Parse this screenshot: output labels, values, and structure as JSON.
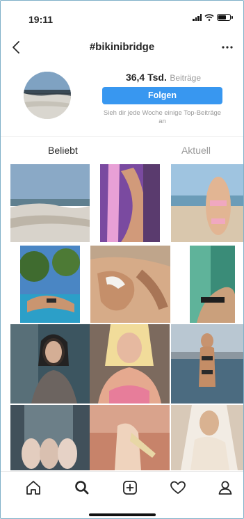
{
  "status_bar": {
    "time": "19:11"
  },
  "nav": {
    "title": "#bikinibridge",
    "back_icon": "chevron-left-icon",
    "more_icon": "more-dots-icon"
  },
  "header": {
    "post_count": "36,4 Tsd.",
    "post_count_label": "Beiträge",
    "follow_label": "Folgen",
    "note": "Sieh dir jede Woche einige Top-Beiträge an"
  },
  "tabs": [
    {
      "label": "Beliebt",
      "active": true
    },
    {
      "label": "Aktuell",
      "active": false
    }
  ],
  "bottom_nav": [
    {
      "icon": "home-icon"
    },
    {
      "icon": "search-icon",
      "active": true
    },
    {
      "icon": "add-post-icon"
    },
    {
      "icon": "heart-icon"
    },
    {
      "icon": "profile-icon"
    }
  ],
  "colors": {
    "accent": "#3897f0",
    "text": "#262626",
    "muted": "#999999"
  }
}
